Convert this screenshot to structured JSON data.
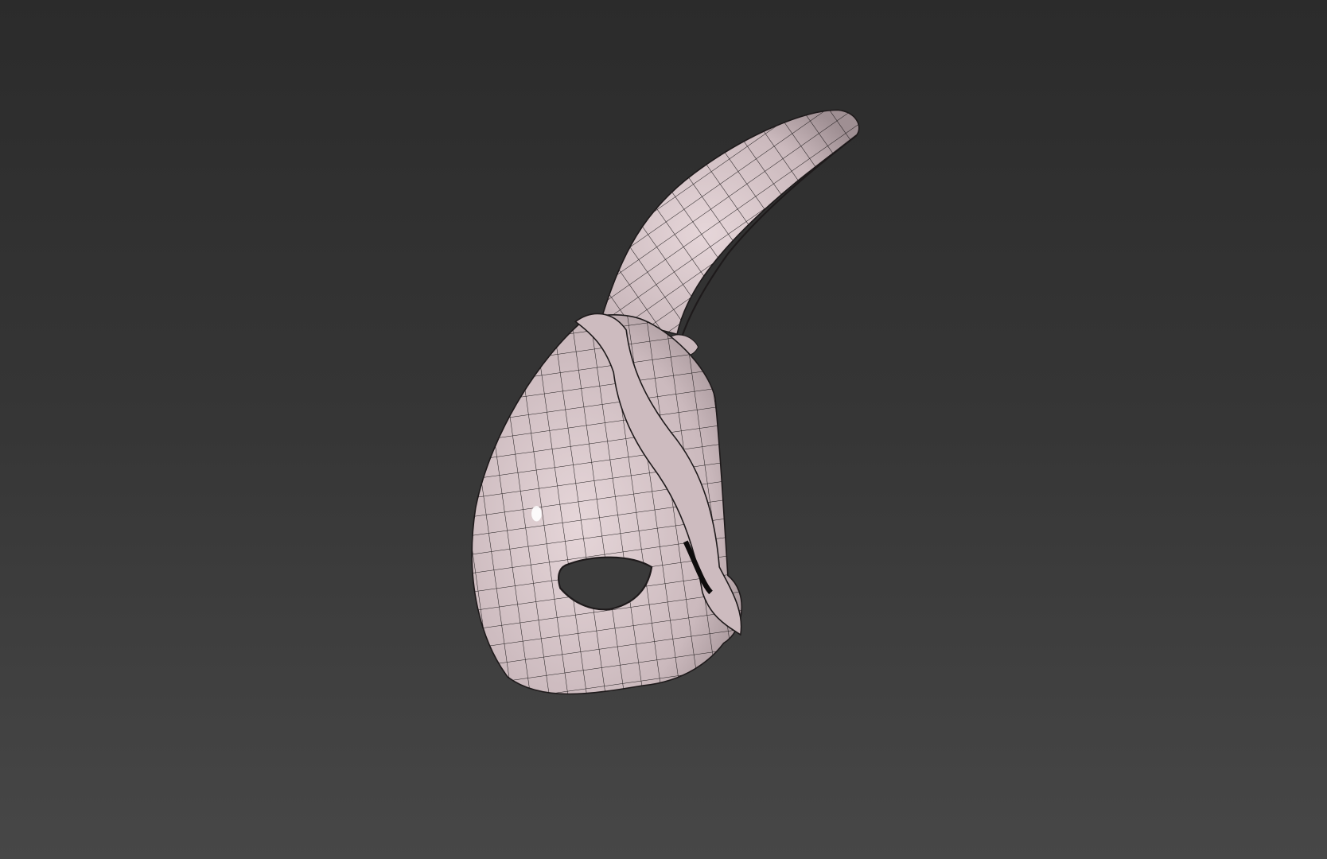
{
  "viewport": {
    "background_top": "#2b2b2b",
    "background_bottom": "#474747",
    "model": {
      "subject": "rabbit-mask",
      "surface_color": "#d8c7ca",
      "shadow_color": "#a8979b",
      "wire_color": "#1e1a1b"
    }
  }
}
